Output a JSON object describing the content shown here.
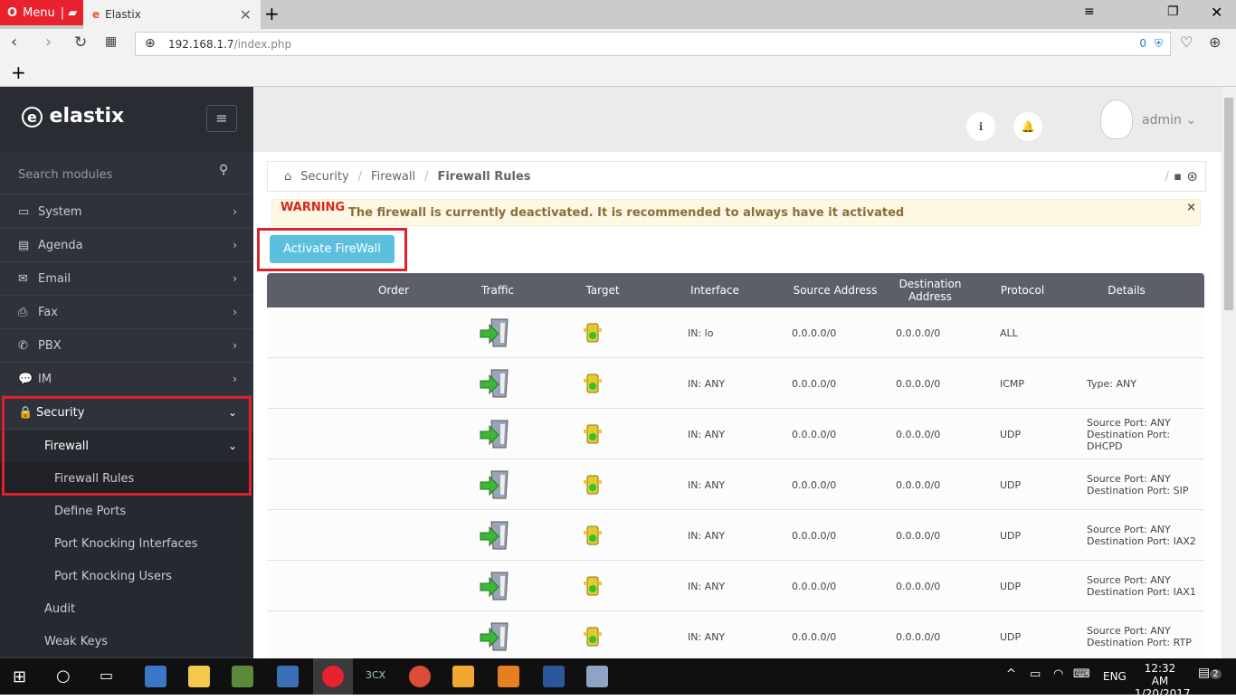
{
  "browser": {
    "menu_label": "Menu",
    "tab_title": "Elastix",
    "url_host": "192.168.1.7",
    "url_path": "/index.php",
    "badge_count": "0"
  },
  "sidebar": {
    "logo": "elastix",
    "search_placeholder": "Search modules",
    "items": [
      {
        "label": "System"
      },
      {
        "label": "Agenda"
      },
      {
        "label": "Email"
      },
      {
        "label": "Fax"
      },
      {
        "label": "PBX"
      },
      {
        "label": "IM"
      },
      {
        "label": "Security"
      }
    ],
    "subitems": [
      {
        "label": "Firewall"
      },
      {
        "label": "Firewall Rules"
      },
      {
        "label": "Define Ports"
      },
      {
        "label": "Port Knocking Interfaces"
      },
      {
        "label": "Port Knocking Users"
      },
      {
        "label": "Audit"
      },
      {
        "label": "Weak Keys"
      }
    ]
  },
  "header": {
    "user": "admin"
  },
  "breadcrumb": [
    "Security",
    "Firewall",
    "Firewall Rules"
  ],
  "warning": {
    "title": "WARNING",
    "message": "The firewall is currently deactivated. It is recommended to always have it activated",
    "close": "×"
  },
  "activate_label": "Activate FireWall",
  "table": {
    "columns": [
      "Order",
      "Traffic",
      "Target",
      "Interface",
      "Source Address",
      "Destination Address",
      "Protocol",
      "Details"
    ],
    "rows": [
      {
        "interface": "IN: lo",
        "source": "0.0.0.0/0",
        "dest": "0.0.0.0/0",
        "protocol": "ALL",
        "details": ""
      },
      {
        "interface": "IN: ANY",
        "source": "0.0.0.0/0",
        "dest": "0.0.0.0/0",
        "protocol": "ICMP",
        "details": "Type: ANY"
      },
      {
        "interface": "IN: ANY",
        "source": "0.0.0.0/0",
        "dest": "0.0.0.0/0",
        "protocol": "UDP",
        "details": "Source Port: ANY\nDestination Port: DHCPD"
      },
      {
        "interface": "IN: ANY",
        "source": "0.0.0.0/0",
        "dest": "0.0.0.0/0",
        "protocol": "UDP",
        "details": "Source Port: ANY\nDestination Port: SIP"
      },
      {
        "interface": "IN: ANY",
        "source": "0.0.0.0/0",
        "dest": "0.0.0.0/0",
        "protocol": "UDP",
        "details": "Source Port: ANY\nDestination Port: IAX2"
      },
      {
        "interface": "IN: ANY",
        "source": "0.0.0.0/0",
        "dest": "0.0.0.0/0",
        "protocol": "UDP",
        "details": "Source Port: ANY\nDestination Port: IAX1"
      },
      {
        "interface": "IN: ANY",
        "source": "0.0.0.0/0",
        "dest": "0.0.0.0/0",
        "protocol": "UDP",
        "details": "Source Port: ANY\nDestination Port: RTP"
      }
    ]
  },
  "taskbar": {
    "lang": "ENG",
    "time": "12:32 AM",
    "date": "1/20/2017",
    "notifications": "2",
    "app_3cx": "3CX"
  }
}
